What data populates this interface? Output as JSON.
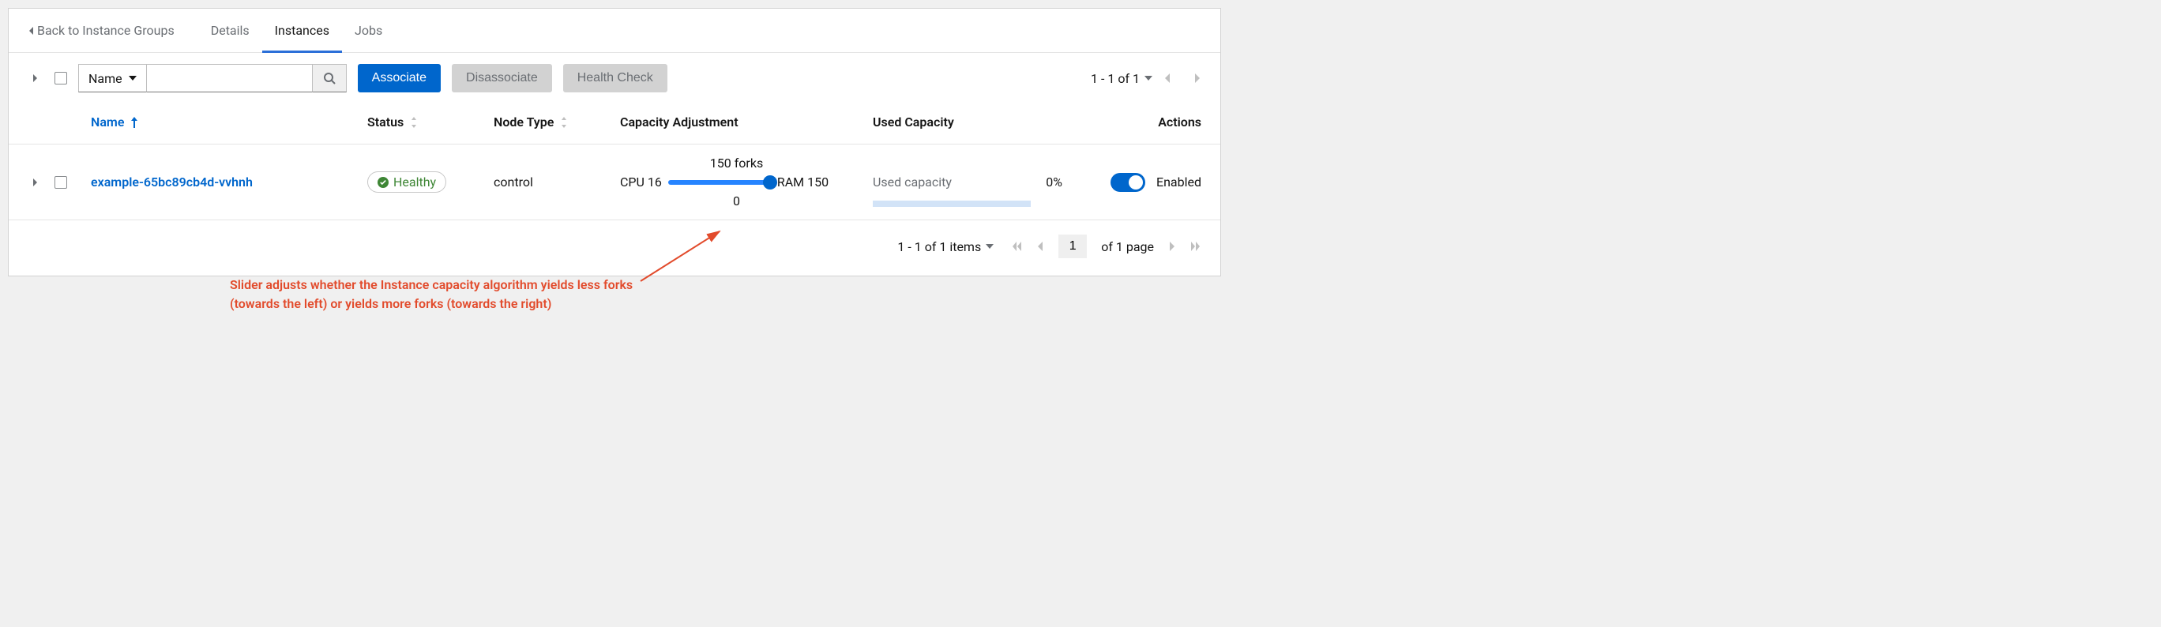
{
  "nav": {
    "back_label": "Back to Instance Groups",
    "tabs": {
      "details": "Details",
      "instances": "Instances",
      "jobs": "Jobs"
    }
  },
  "toolbar": {
    "filter_field": "Name",
    "search_placeholder": "",
    "associate": "Associate",
    "disassociate": "Disassociate",
    "health_check": "Health Check",
    "top_range": "1 - 1 of 1"
  },
  "columns": {
    "name": "Name",
    "status": "Status",
    "node_type": "Node Type",
    "capacity_adjustment": "Capacity Adjustment",
    "used_capacity": "Used Capacity",
    "actions": "Actions"
  },
  "row": {
    "name": "example-65bc89cb4d-vvhnh",
    "status_label": "Healthy",
    "node_type": "control",
    "cap_cpu_label": "CPU 16",
    "cap_ram_label": "RAM 150",
    "cap_top": "150 forks",
    "cap_bottom": "0",
    "used_label": "Used capacity",
    "used_pct": "0%",
    "enabled_label": "Enabled"
  },
  "annotation": {
    "text": "Slider adjusts whether the Instance capacity algorithm yields less forks (towards the left) or yields more forks (towards the right)"
  },
  "footer": {
    "items": "1 - 1 of 1 items",
    "page_value": "1",
    "of_page": "of 1 page"
  }
}
